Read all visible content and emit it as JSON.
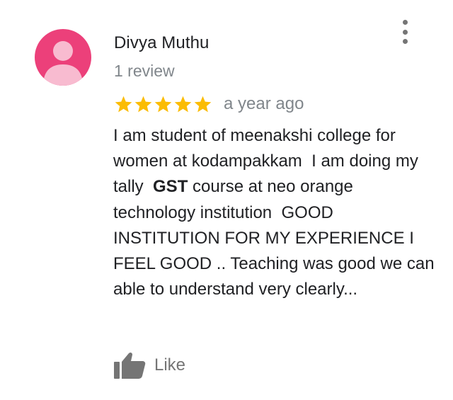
{
  "review": {
    "author_name": "Divya Muthu",
    "review_count": "1 review",
    "rating": 5,
    "rating_max": 5,
    "time_ago": "a year ago",
    "text_parts": [
      "I am student of meenakshi college for women at kodampakkam  I am doing my  tally  ",
      "GST",
      " course at neo orange technology institution  GOOD INSTITUTION FOR MY EXPERIENCE I FEEL GOOD .. Teaching was good we can able to understand very clearly..."
    ],
    "like_label": "Like"
  },
  "colors": {
    "avatar_bg": "#ec407a",
    "avatar_figure": "#f8bbd0",
    "star": "#fbbc04",
    "secondary_text": "#80868b",
    "icon_gray": "#757575"
  },
  "icons": {
    "menu": "more-vert-icon",
    "star": "star-icon",
    "like": "thumb-up-icon"
  }
}
